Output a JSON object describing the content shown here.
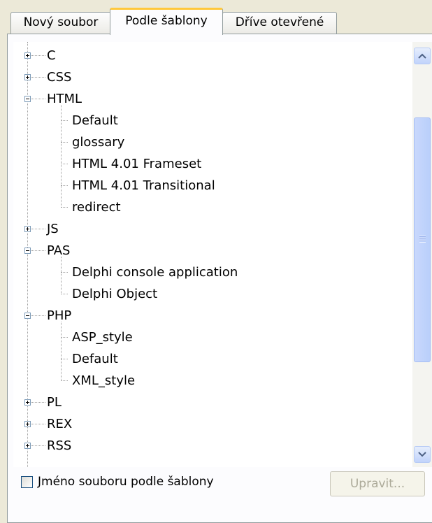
{
  "tabs": [
    {
      "label": "Nový soubor",
      "active": false
    },
    {
      "label": "Podle šablony",
      "active": true
    },
    {
      "label": "Dříve otevřené",
      "active": false
    }
  ],
  "tree": {
    "items": [
      {
        "label": "C",
        "expander": "plus"
      },
      {
        "label": "CSS",
        "expander": "plus"
      },
      {
        "label": "HTML",
        "expander": "minus",
        "children": [
          {
            "label": "Default"
          },
          {
            "label": "glossary"
          },
          {
            "label": "HTML 4.01 Frameset"
          },
          {
            "label": "HTML 4.01 Transitional"
          },
          {
            "label": "redirect"
          }
        ]
      },
      {
        "label": "JS",
        "expander": "plus"
      },
      {
        "label": "PAS",
        "expander": "minus",
        "children": [
          {
            "label": "Delphi console application"
          },
          {
            "label": "Delphi Object"
          }
        ]
      },
      {
        "label": "PHP",
        "expander": "minus",
        "children": [
          {
            "label": "ASP_style"
          },
          {
            "label": "Default"
          },
          {
            "label": "XML_style"
          }
        ]
      },
      {
        "label": "PL",
        "expander": "plus"
      },
      {
        "label": "REX",
        "expander": "plus"
      },
      {
        "label": "RSS",
        "expander": "plus"
      }
    ]
  },
  "footer": {
    "checkbox_label": "Jméno souboru podle šablony",
    "checkbox_checked": false,
    "edit_button_label": "Upravit...",
    "edit_button_enabled": false
  },
  "icons": {
    "expand": "plus-box-icon",
    "collapse": "minus-box-icon",
    "scroll_up": "chevron-up-icon",
    "scroll_down": "chevron-down-icon"
  },
  "colors": {
    "window_bg": "#ece9d8",
    "tab_active_accent": "#ffc83c",
    "scrollbar": "#c1d3fb",
    "disabled_text": "#acaa99"
  }
}
